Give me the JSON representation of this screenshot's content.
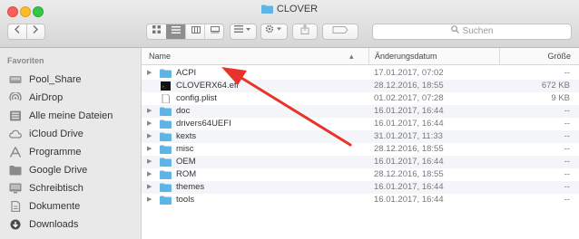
{
  "window": {
    "title": "CLOVER"
  },
  "toolbar": {
    "back_icon": "chevron-left-icon",
    "forward_icon": "chevron-right-icon",
    "view_modes": [
      "icon-view-icon",
      "list-view-icon",
      "column-view-icon",
      "cover-flow-icon"
    ],
    "arrange_icon": "arrange-menu-icon",
    "action_icon": "gear-menu-icon",
    "share_icon": "share-icon",
    "tag_icon": "tag-icon",
    "search_placeholder": "Suchen"
  },
  "sidebar": {
    "heading": "Favoriten",
    "items": [
      {
        "label": "Pool_Share",
        "icon": "drive-icon"
      },
      {
        "label": "AirDrop",
        "icon": "airdrop-icon"
      },
      {
        "label": "Alle meine Dateien",
        "icon": "all-files-icon"
      },
      {
        "label": "iCloud Drive",
        "icon": "cloud-icon"
      },
      {
        "label": "Programme",
        "icon": "applications-icon"
      },
      {
        "label": "Google Drive",
        "icon": "folder-icon"
      },
      {
        "label": "Schreibtisch",
        "icon": "desktop-icon"
      },
      {
        "label": "Dokumente",
        "icon": "documents-icon"
      },
      {
        "label": "Downloads",
        "icon": "downloads-icon"
      }
    ]
  },
  "list": {
    "columns": {
      "name": "Name",
      "date": "Änderungsdatum",
      "size": "Größe"
    },
    "rows": [
      {
        "name": "ACPI",
        "date": "17.01.2017, 07:02",
        "size": "--",
        "type": "folder"
      },
      {
        "name": "CLOVERX64.efi",
        "date": "28.12.2016, 18:55",
        "size": "672 KB",
        "type": "exec"
      },
      {
        "name": "config.plist",
        "date": "01.02.2017, 07:28",
        "size": "9 KB",
        "type": "file"
      },
      {
        "name": "doc",
        "date": "16.01.2017, 16:44",
        "size": "--",
        "type": "folder"
      },
      {
        "name": "drivers64UEFI",
        "date": "16.01.2017, 16:44",
        "size": "--",
        "type": "folder"
      },
      {
        "name": "kexts",
        "date": "31.01.2017, 11:33",
        "size": "--",
        "type": "folder"
      },
      {
        "name": "misc",
        "date": "28.12.2016, 18:55",
        "size": "--",
        "type": "folder"
      },
      {
        "name": "OEM",
        "date": "16.01.2017, 16:44",
        "size": "--",
        "type": "folder"
      },
      {
        "name": "ROM",
        "date": "28.12.2016, 18:55",
        "size": "--",
        "type": "folder"
      },
      {
        "name": "themes",
        "date": "16.01.2017, 16:44",
        "size": "--",
        "type": "folder"
      },
      {
        "name": "tools",
        "date": "16.01.2017, 16:44",
        "size": "--",
        "type": "folder"
      }
    ]
  },
  "colors": {
    "folder": "#5fb4e6",
    "arrow": "#e8332a",
    "stripe": "#f3f5f8",
    "sidebar": "#e9e9ea"
  }
}
